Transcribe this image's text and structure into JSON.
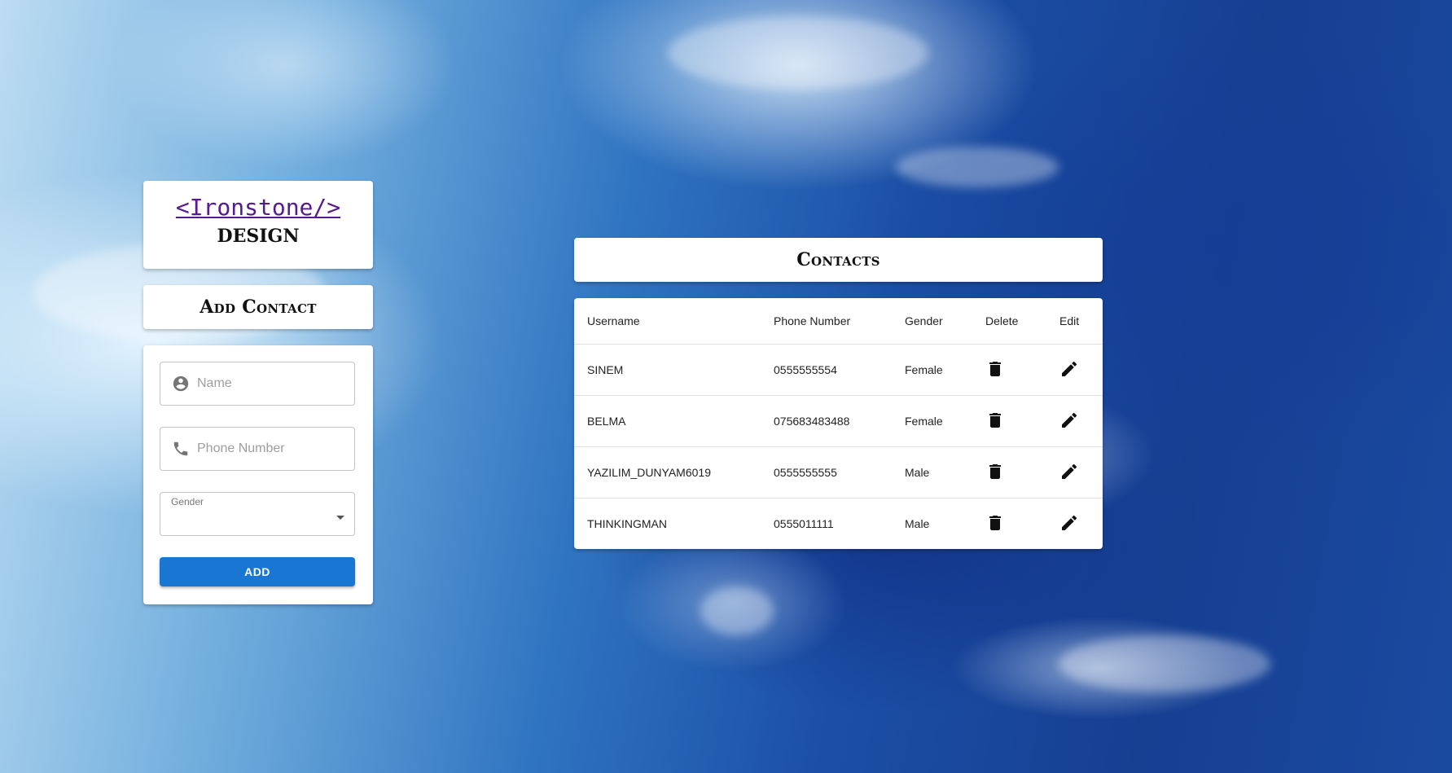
{
  "logo": {
    "link_text": "<Ironstone/>",
    "subtitle": "DESIGN"
  },
  "add_contact": {
    "title": "Add Contact",
    "name_placeholder": "Name",
    "phone_placeholder": "Phone Number",
    "gender_label": "Gender",
    "gender_value": "",
    "add_label": "ADD",
    "button_color": "#1976d2"
  },
  "contacts": {
    "title": "Contacts",
    "columns": [
      "Username",
      "Phone Number",
      "Gender",
      "Delete",
      "Edit"
    ],
    "rows": [
      {
        "username": "SINEM",
        "phone": "0555555554",
        "gender": "Female"
      },
      {
        "username": "BELMA",
        "phone": "075683483488",
        "gender": "Female"
      },
      {
        "username": "YAZILIM_DUNYAM6019",
        "phone": "0555555555",
        "gender": "Male"
      },
      {
        "username": "THINKINGMAN",
        "phone": "0555011111",
        "gender": "Male"
      }
    ],
    "delete_icon": "trash-icon",
    "edit_icon": "pencil-icon"
  }
}
